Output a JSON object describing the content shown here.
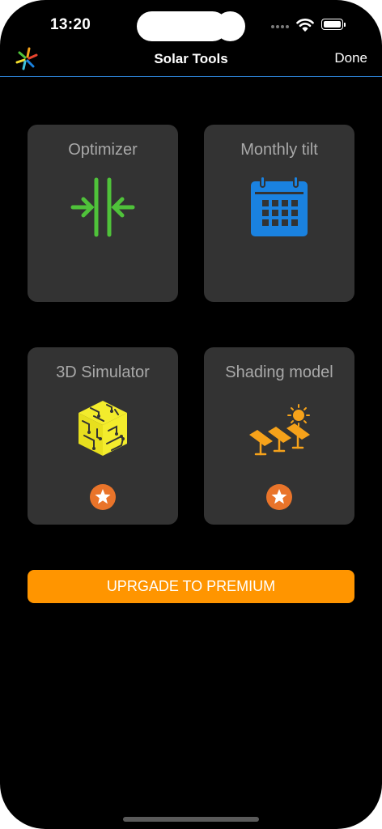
{
  "status_bar": {
    "time": "13:20",
    "signal_icon": "cellular-signal-icon",
    "wifi_icon": "wifi-icon",
    "battery_icon": "battery-icon"
  },
  "nav": {
    "logo_icon": "solar-tools-logo-icon",
    "title": "Solar Tools",
    "done_label": "Done",
    "divider_color": "#2a7bc9"
  },
  "tools": [
    {
      "label": "Optimizer",
      "icon": "arrows-converge-icon",
      "icon_color": "#4fc23a",
      "premium": false
    },
    {
      "label": "Monthly tilt",
      "icon": "calendar-icon",
      "icon_color": "#1a82e0",
      "premium": false
    },
    {
      "label": "3D Simulator",
      "icon": "circuit-cube-icon",
      "icon_color": "#f3ec2c",
      "premium": true
    },
    {
      "label": "Shading model",
      "icon": "solar-panels-sun-icon",
      "icon_color": "#f6a21a",
      "premium": true
    }
  ],
  "premium_badge": {
    "icon": "star-icon",
    "color": "#e9742a"
  },
  "upgrade_button": {
    "label": "UPRGADE TO PREMIUM",
    "color": "#ff9500"
  }
}
